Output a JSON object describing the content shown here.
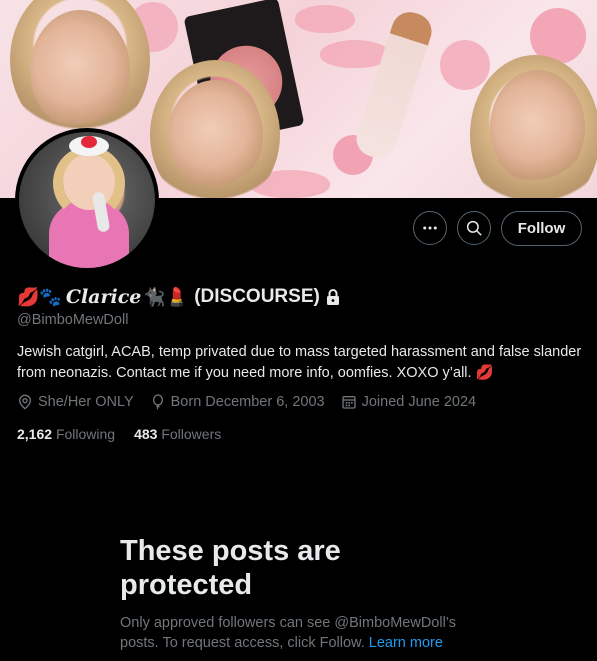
{
  "profile": {
    "display_name_prefix_emoji": "💋🐾",
    "display_name_script": "Clarice",
    "display_name_suffix_emoji": "🐈‍⬛💄",
    "display_name_tag": "(DISCOURSE)",
    "handle": "@BimboMewDoll",
    "bio": "Jewish catgirl, ACAB, temp privated due to mass targeted harassment and false slander from neonazis. Contact me if you need more info, oomfies. XOXO y’all. 💋",
    "pronouns": "She/Her ONLY",
    "birthday": "Born December 6, 2003",
    "joined": "Joined June 2024",
    "following_count": "2,162",
    "following_label": "Following",
    "followers_count": "483",
    "followers_label": "Followers"
  },
  "actions": {
    "more_icon": "more-horizontal-icon",
    "search_icon": "search-icon",
    "follow_label": "Follow"
  },
  "protected": {
    "title": "These posts are protected",
    "text": "Only approved followers can see @BimboMewDoll’s posts. To request access, click Follow.",
    "learn_more": "Learn more"
  },
  "colors": {
    "background": "#000000",
    "primary_text": "#e7e9ea",
    "secondary_text": "#71767b",
    "link": "#1d9bf0",
    "border": "#536471"
  }
}
